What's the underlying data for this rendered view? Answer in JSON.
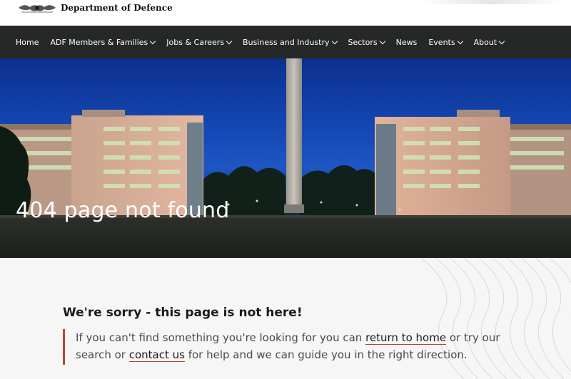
{
  "header": {
    "department": "Department of Defence"
  },
  "nav": {
    "items": [
      {
        "label": "Home",
        "dropdown": false
      },
      {
        "label": "ADF Members & Families",
        "dropdown": true
      },
      {
        "label": "Jobs & Careers",
        "dropdown": true
      },
      {
        "label": "Business and Industry",
        "dropdown": true
      },
      {
        "label": "Sectors",
        "dropdown": true
      },
      {
        "label": "News",
        "dropdown": false
      },
      {
        "label": "Events",
        "dropdown": true
      },
      {
        "label": "About",
        "dropdown": true
      }
    ]
  },
  "hero": {
    "title": "404 page not found"
  },
  "content": {
    "heading": "We're sorry - this page is not here!",
    "text_1": "If you can't find something you're looking for you can ",
    "link_home": "return to home",
    "text_2": " or try our search or ",
    "link_contact": "contact us",
    "text_3": " for help and we can guide you in the right direction."
  },
  "colors": {
    "nav_bg": "#262727",
    "accent": "#b8452b",
    "sky": "#1447b3"
  }
}
